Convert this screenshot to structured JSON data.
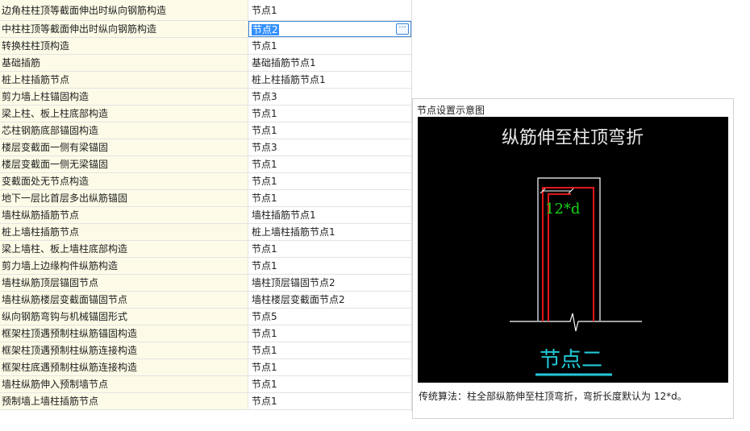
{
  "settings": {
    "rows": [
      {
        "name": "边角柱柱顶等截面伸出时纵向钢筋构造",
        "value": "节点1"
      },
      {
        "name": "中柱柱顶等截面伸出时纵向钢筋构造",
        "value": "节点2"
      },
      {
        "name": "转换柱柱顶构造",
        "value": "节点1"
      },
      {
        "name": "基础插筋",
        "value": "基础插筋节点1"
      },
      {
        "name": "桩上柱插筋节点",
        "value": "桩上柱插筋节点1"
      },
      {
        "name": "剪力墙上柱锚固构造",
        "value": "节点3"
      },
      {
        "name": "梁上柱、板上柱底部构造",
        "value": "节点1"
      },
      {
        "name": "芯柱钢筋底部锚固构造",
        "value": "节点1"
      },
      {
        "name": "楼层变截面一侧有梁锚固",
        "value": "节点3"
      },
      {
        "name": "楼层变截面一侧无梁锚固",
        "value": "节点1"
      },
      {
        "name": "变截面处无节点构造",
        "value": "节点1"
      },
      {
        "name": "地下一层比首层多出纵筋锚固",
        "value": "节点1"
      },
      {
        "name": "墙柱纵筋插筋节点",
        "value": "墙柱插筋节点1"
      },
      {
        "name": "桩上墙柱插筋节点",
        "value": "桩上墙柱插筋节点1"
      },
      {
        "name": "梁上墙柱、板上墙柱底部构造",
        "value": "节点1"
      },
      {
        "name": "剪力墙上边缘构件纵筋构造",
        "value": "节点1"
      },
      {
        "name": "墙柱纵筋顶层锚固节点",
        "value": "墙柱顶层锚固节点2"
      },
      {
        "name": "墙柱纵筋楼层变截面锚固节点",
        "value": "墙柱楼层变截面节点2"
      },
      {
        "name": "纵向钢筋弯钩与机械锚固形式",
        "value": "节点5"
      },
      {
        "name": "框架柱顶遇预制柱纵筋锚固构造",
        "value": "节点1"
      },
      {
        "name": "框架柱顶遇预制柱纵筋连接构造",
        "value": "节点1"
      },
      {
        "name": "框架柱底遇预制柱纵筋连接构造",
        "value": "节点1"
      },
      {
        "name": "墙柱纵筋伸入预制墙节点",
        "value": "节点1"
      },
      {
        "name": "预制墙上墙柱插筋节点",
        "value": "节点1"
      }
    ],
    "active_index": 1,
    "ellipsis_label": "···"
  },
  "preview": {
    "title": "节点设置示意图",
    "diagram_heading": "纵筋伸至柱顶弯折",
    "dimension_label": "12*d",
    "node_label": "节点二",
    "description": "传统算法：柱全部纵筋伸至柱顶弯折，弯折长度默认为 12*d。",
    "colors": {
      "background": "#000000",
      "outline": "#ffffff",
      "rebar": "#e01818",
      "dimension": "#19d219",
      "node_label": "#22c8d8"
    }
  }
}
